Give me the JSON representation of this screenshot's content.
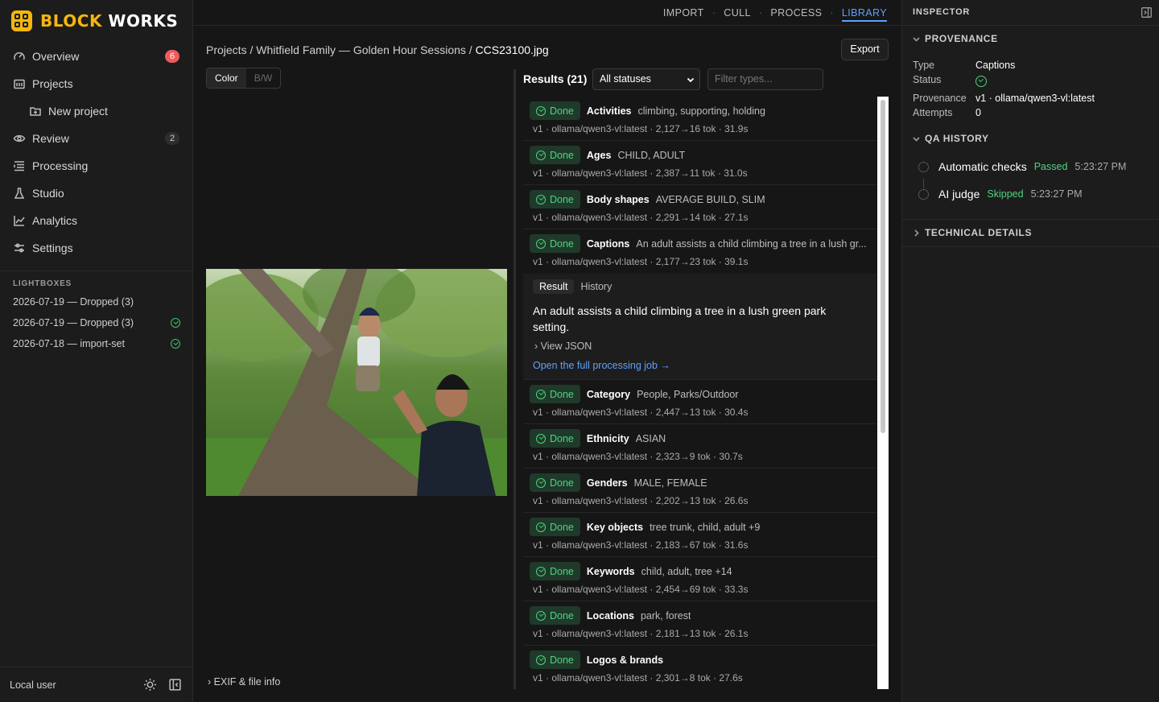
{
  "brand": {
    "part1": "BLOCK",
    "part2": "WORKS"
  },
  "sidebar": {
    "nav": [
      {
        "label": "Overview",
        "icon": "gauge-icon",
        "badge": "6"
      },
      {
        "label": "Projects",
        "icon": "projects-icon"
      },
      {
        "label": "New project",
        "icon": "new-folder-icon"
      },
      {
        "label": "Review",
        "icon": "eye-icon",
        "badge": "2"
      },
      {
        "label": "Processing",
        "icon": "list-icon"
      },
      {
        "label": "Studio",
        "icon": "flask-icon"
      },
      {
        "label": "Analytics",
        "icon": "chart-icon"
      },
      {
        "label": "Settings",
        "icon": "sliders-icon"
      }
    ],
    "lightboxes_title": "LIGHTBOXES",
    "lightboxes": [
      {
        "label": "2026-07-19 — Dropped (3)",
        "done": false
      },
      {
        "label": "2026-07-19 — Dropped (3)",
        "done": true
      },
      {
        "label": "2026-07-18 — import-set",
        "done": true
      }
    ],
    "user": "Local user"
  },
  "topnav": {
    "items": [
      "IMPORT",
      "CULL",
      "PROCESS",
      "LIBRARY"
    ],
    "active": "LIBRARY"
  },
  "breadcrumb": {
    "path": "Projects / Whitfield Family — Golden Hour Sessions / ",
    "current": "CCS23100.jpg"
  },
  "export_label": "Export",
  "view_toggle": {
    "color": "Color",
    "bw": "B/W"
  },
  "exif_label": "EXIF & file info",
  "results": {
    "title": "Results (21)",
    "status_filter": "All statuses",
    "type_filter_placeholder": "Filter types...",
    "done_label": "Done",
    "rows_before": [
      {
        "name": "Activities",
        "value": "climbing, supporting, holding",
        "meta": "v1 · ollama/qwen3-vl:latest · 2,127→16 tok · 31.9s"
      },
      {
        "name": "Ages",
        "value": "CHILD, ADULT",
        "meta": "v1 · ollama/qwen3-vl:latest · 2,387→11 tok · 31.0s"
      },
      {
        "name": "Body shapes",
        "value": "AVERAGE BUILD, SLIM",
        "meta": "v1 · ollama/qwen3-vl:latest · 2,291→14 tok · 27.1s"
      },
      {
        "name": "Captions",
        "value": "An adult assists a child climbing a tree in a lush gr...",
        "meta": "v1 · ollama/qwen3-vl:latest · 2,177→23 tok · 39.1s"
      }
    ],
    "expanded": {
      "tab_result": "Result",
      "tab_history": "History",
      "text": "An adult assists a child climbing a tree in a lush green park setting.",
      "view_json": "View JSON",
      "open_link": "Open the full processing job →"
    },
    "rows_after": [
      {
        "name": "Category",
        "value": "People, Parks/Outdoor",
        "meta": "v1 · ollama/qwen3-vl:latest · 2,447→13 tok · 30.4s"
      },
      {
        "name": "Ethnicity",
        "value": "ASIAN",
        "meta": "v1 · ollama/qwen3-vl:latest · 2,323→9 tok · 30.7s"
      },
      {
        "name": "Genders",
        "value": "MALE, FEMALE",
        "meta": "v1 · ollama/qwen3-vl:latest · 2,202→13 tok · 26.6s"
      },
      {
        "name": "Key objects",
        "value": "tree trunk, child, adult +9",
        "meta": "v1 · ollama/qwen3-vl:latest · 2,183→67 tok · 31.6s"
      },
      {
        "name": "Keywords",
        "value": "child, adult, tree +14",
        "meta": "v1 · ollama/qwen3-vl:latest · 2,454→69 tok · 33.3s"
      },
      {
        "name": "Locations",
        "value": "park, forest",
        "meta": "v1 · ollama/qwen3-vl:latest · 2,181→13 tok · 26.1s"
      },
      {
        "name": "Logos & brands",
        "value": "",
        "meta": "v1 · ollama/qwen3-vl:latest · 2,301→8 tok · 27.6s"
      }
    ]
  },
  "inspector": {
    "title": "INSPECTOR",
    "provenance_title": "PROVENANCE",
    "type_key": "Type",
    "type_val": "Captions",
    "status_key": "Status",
    "prov_key": "Provenance",
    "prov_val": "v1 · ollama/qwen3-vl:latest",
    "attempts_key": "Attempts",
    "attempts_val": "0",
    "qa_title": "QA HISTORY",
    "qa": [
      {
        "name": "Automatic checks",
        "status": "Passed",
        "time": "5:23:27 PM"
      },
      {
        "name": "AI judge",
        "status": "Skipped",
        "time": "5:23:27 PM"
      }
    ],
    "tech_title": "TECHNICAL DETAILS"
  },
  "colors": {
    "accent": "#5ea0ff",
    "brand": "#f5b60d",
    "success": "#4ed37e",
    "badge": "#ef5b5b"
  }
}
